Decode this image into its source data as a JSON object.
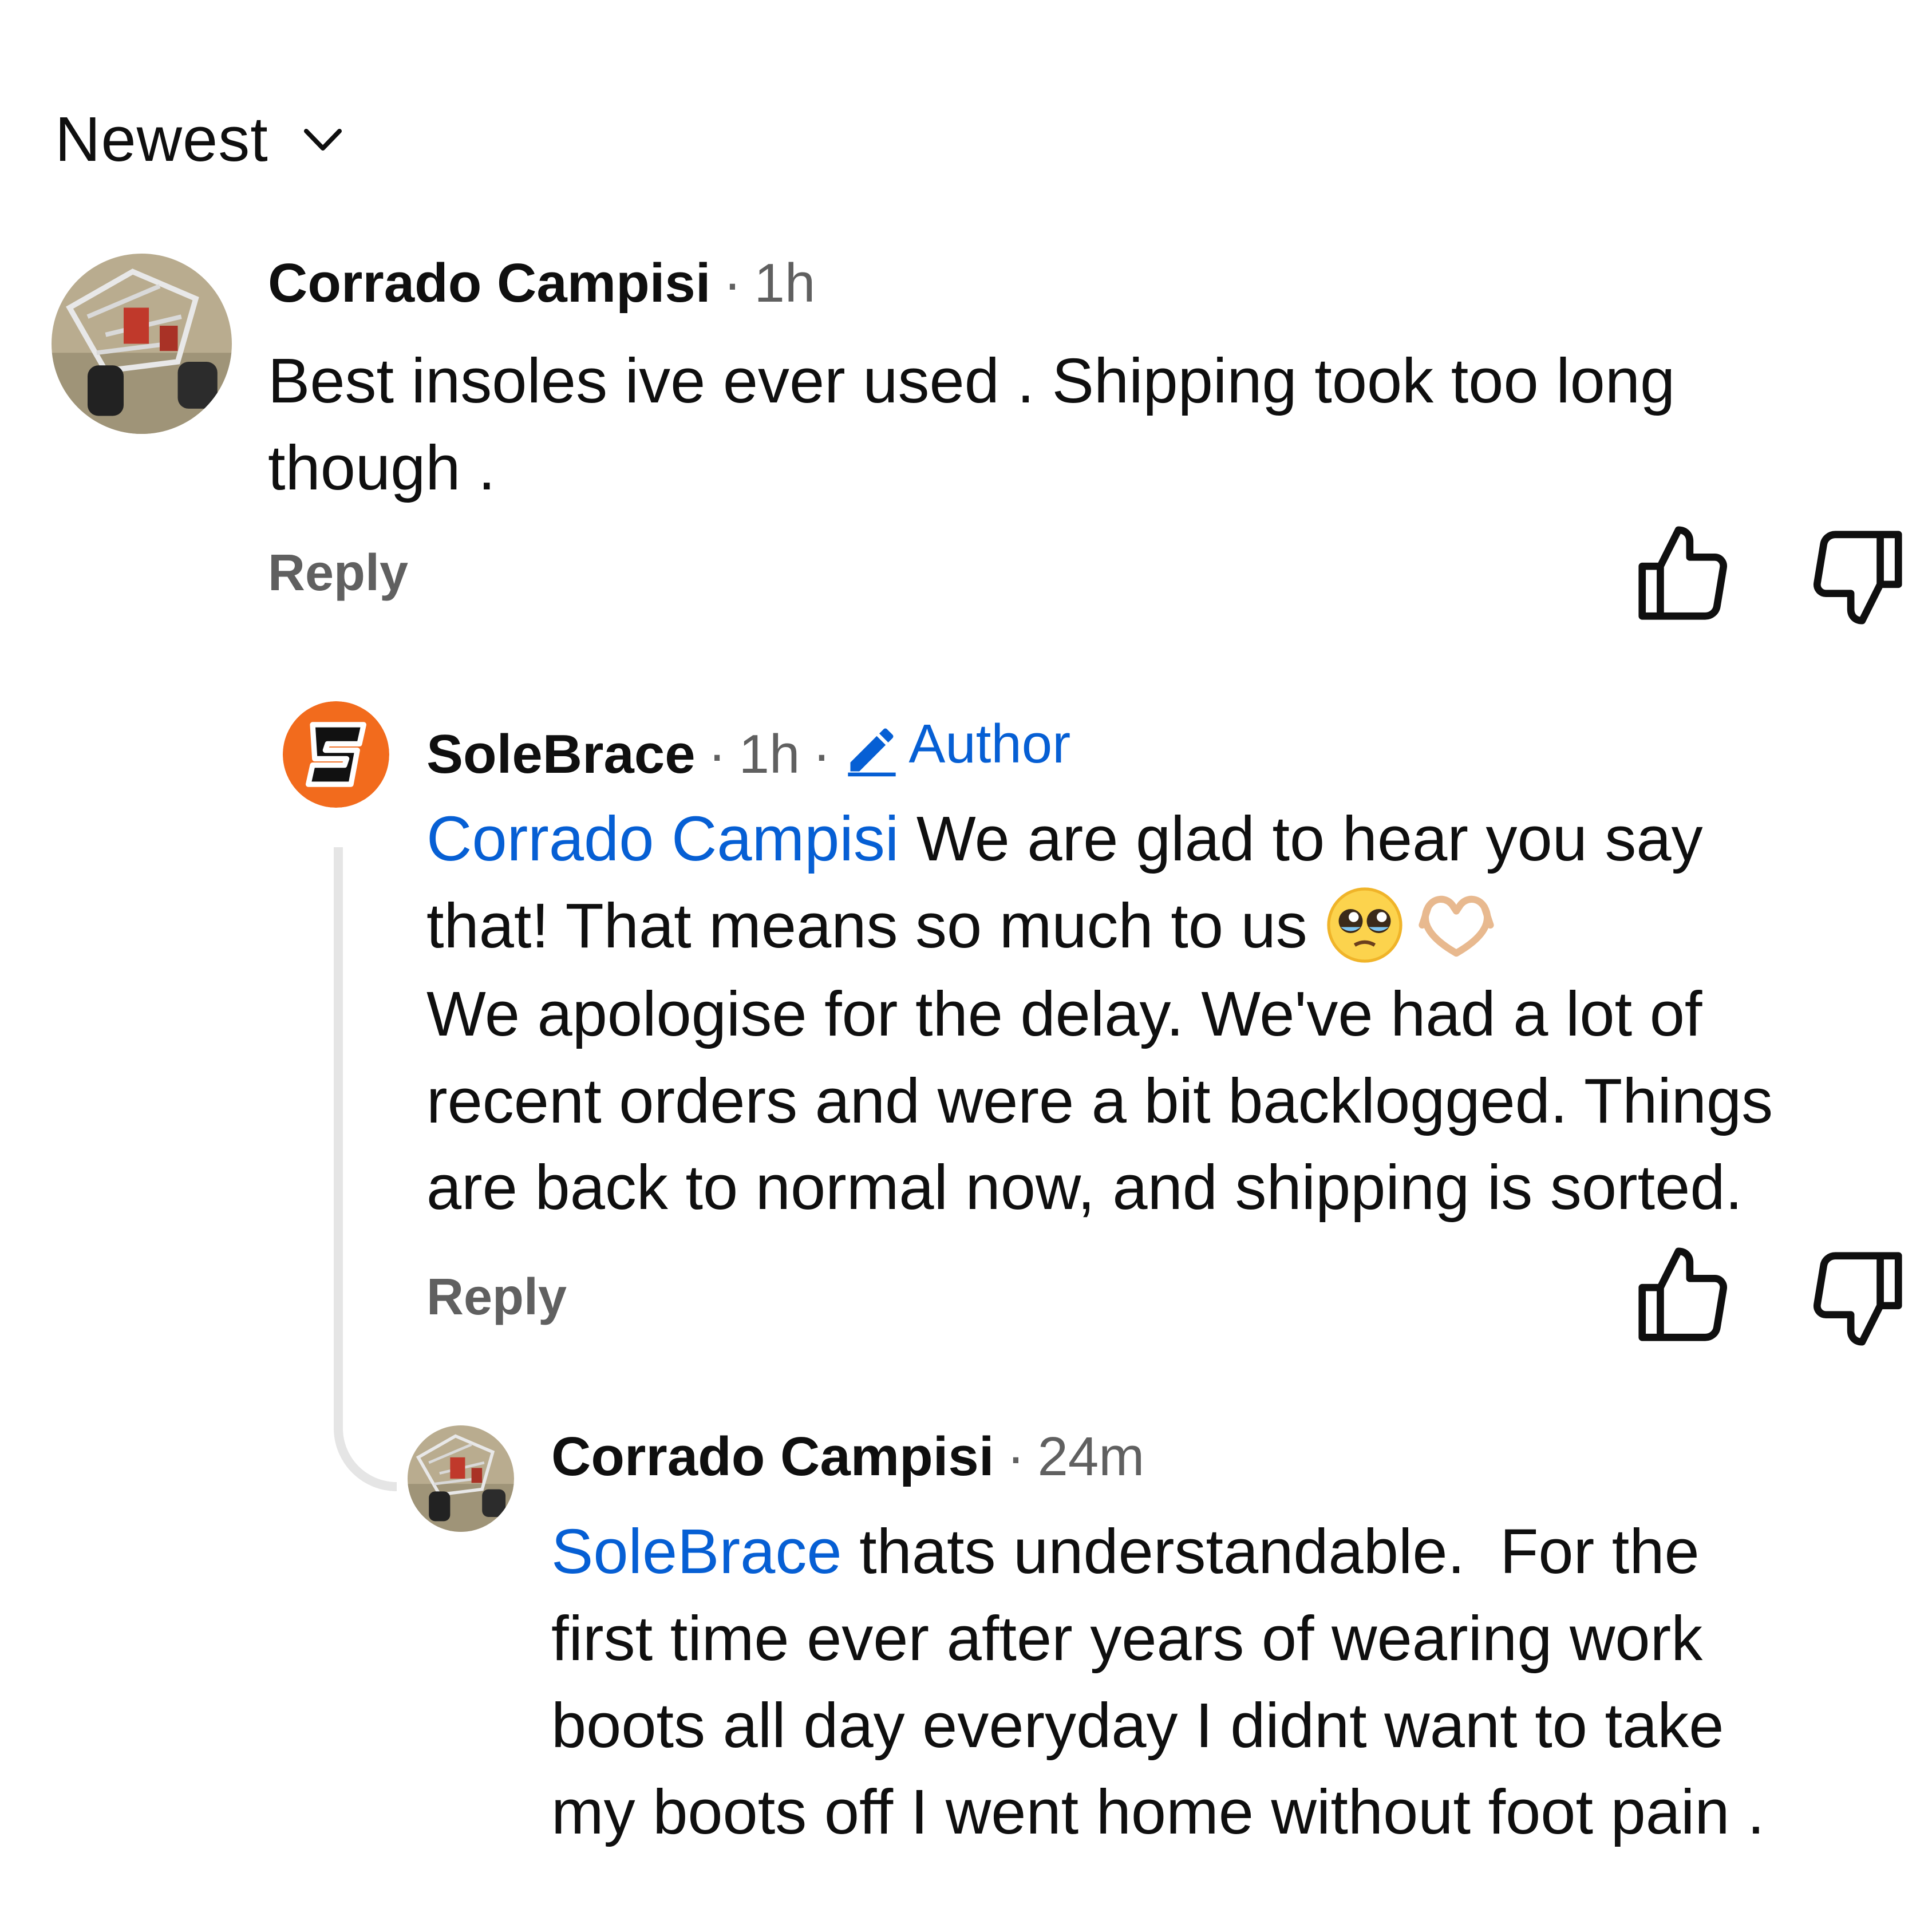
{
  "sort": {
    "label": "Newest",
    "icon": "chevron-down-icon"
  },
  "comments": [
    {
      "author": "Corrado Campisi",
      "separator": "·",
      "time": "1h",
      "lines": [
        "Best insoles ive ever used . Shipping took too long",
        "though ."
      ],
      "reply_label": "Reply",
      "avatar": "avatar-photo"
    },
    {
      "author": "SoleBrace",
      "separator": "·",
      "time": "1h",
      "badge": "Author",
      "badge_icon": "pencil-icon",
      "mention": "Corrado Campisi",
      "line1_rest": " We are glad to hear you say",
      "line2": "that! That means so much to us ",
      "emojis": [
        "pleading-face-emoji",
        "heart-hands-emoji"
      ],
      "lines_rest": [
        "We apologise for the delay. We've had a lot of",
        "recent orders and were a bit backlogged. Things",
        "are back to normal now, and shipping is sorted."
      ],
      "reply_label": "Reply",
      "avatar": "solebrace-logo"
    },
    {
      "author": "Corrado Campisi",
      "separator": "·",
      "time": "24m",
      "mention": "SoleBrace",
      "line1_rest": " thats understandable.  For the",
      "lines_rest": [
        "first time ever after years of wearing work",
        "boots all day everyday I didnt want to take",
        "my boots off I went home without foot pain ."
      ],
      "avatar": "avatar-photo"
    }
  ],
  "colors": {
    "text": "#0f0f0f",
    "secondary": "#606060",
    "link": "#065fd4",
    "thread_line": "#e5e5e5",
    "brand_orange": "#f26b1d"
  }
}
